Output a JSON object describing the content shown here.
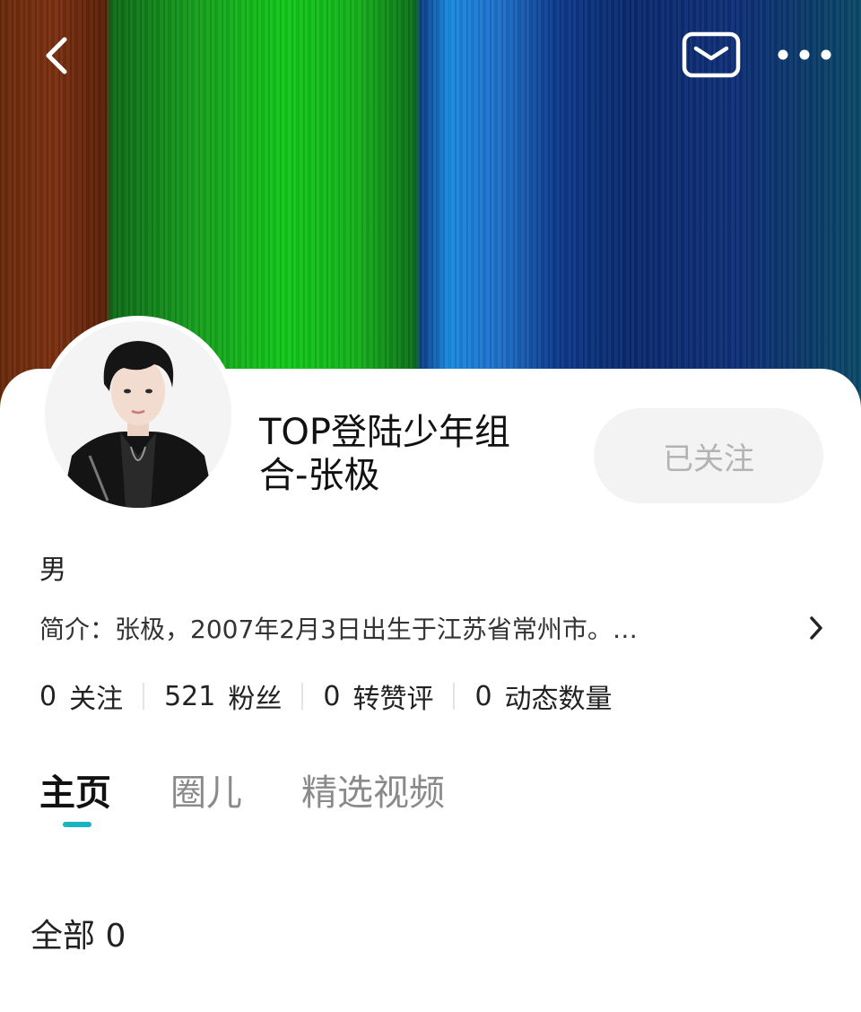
{
  "header": {
    "back_icon": "back-arrow-icon",
    "mail_icon": "mail-icon",
    "more_icon": "more-dots-icon"
  },
  "profile": {
    "name": "TOP登陆少年组合-张极",
    "follow_label": "已关注",
    "gender": "男",
    "bio": "简介：张极，2007年2月3日出生于江苏省常州市。…"
  },
  "stats": [
    {
      "value": "0",
      "label": "关注"
    },
    {
      "value": "521",
      "label": "粉丝"
    },
    {
      "value": "0",
      "label": "转赞评"
    },
    {
      "value": "0",
      "label": "动态数量"
    }
  ],
  "tabs": [
    {
      "label": "主页"
    },
    {
      "label": "圈儿"
    },
    {
      "label": "精选视频"
    }
  ],
  "content": {
    "all_label": "全部 0"
  },
  "colors": {
    "accent": "#19b4c2",
    "follow_bg": "#f3f3f3",
    "follow_text": "#b3b3b3"
  }
}
